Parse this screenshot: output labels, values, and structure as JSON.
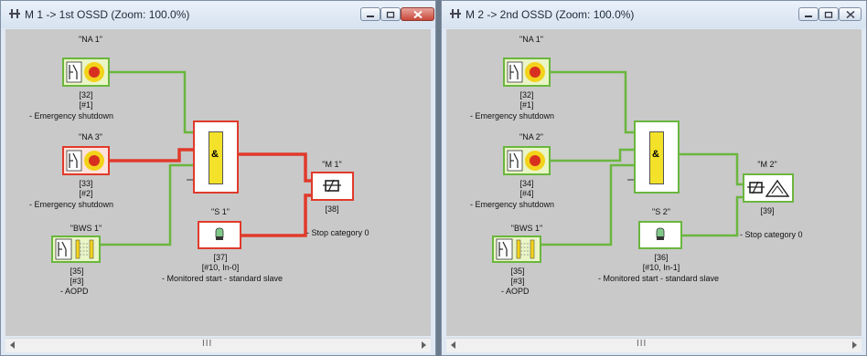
{
  "windows": [
    {
      "title": "M 1  -> 1st OSSD (Zoom: 100.0%)",
      "active": true,
      "blocks": [
        {
          "name": "\"NA 1\"",
          "num": "[32]",
          "idx": "[#1]",
          "desc": "- Emergency shutdown"
        },
        {
          "name": "\"NA 3\"",
          "num": "[33]",
          "idx": "[#2]",
          "desc": "- Emergency shutdown"
        },
        {
          "name": "\"BWS 1\"",
          "num": "[35]",
          "idx": "[#3]",
          "desc": "- AOPD"
        }
      ],
      "start": {
        "name": "\"S 1\"",
        "num": "[37]",
        "idx": "[#10, In-0]",
        "desc": "- Monitored start - standard slave"
      },
      "and_label": "&",
      "output": {
        "name": "\"M 1\"",
        "num": "[38]",
        "desc": "- Stop category 0"
      },
      "scroll_grip": "III"
    },
    {
      "title": "M 2  -> 2nd OSSD (Zoom: 100.0%)",
      "active": false,
      "blocks": [
        {
          "name": "\"NA 1\"",
          "num": "[32]",
          "idx": "[#1]",
          "desc": "- Emergency shutdown"
        },
        {
          "name": "\"NA 2\"",
          "num": "[34]",
          "idx": "[#4]",
          "desc": "- Emergency shutdown"
        },
        {
          "name": "\"BWS 1\"",
          "num": "[35]",
          "idx": "[#3]",
          "desc": "- AOPD"
        }
      ],
      "start": {
        "name": "\"S 2\"",
        "num": "[36]",
        "idx": "[#10, In-1]",
        "desc": "- Monitored start - standard slave"
      },
      "and_label": "&",
      "output": {
        "name": "\"M 2\"",
        "num": "[39]",
        "desc": "- Stop category 0"
      },
      "scroll_grip": "III"
    }
  ],
  "colors": {
    "green_wire": "#6ab63e",
    "red_wire": "#e03a2b",
    "and_fill": "#f3e12a"
  }
}
